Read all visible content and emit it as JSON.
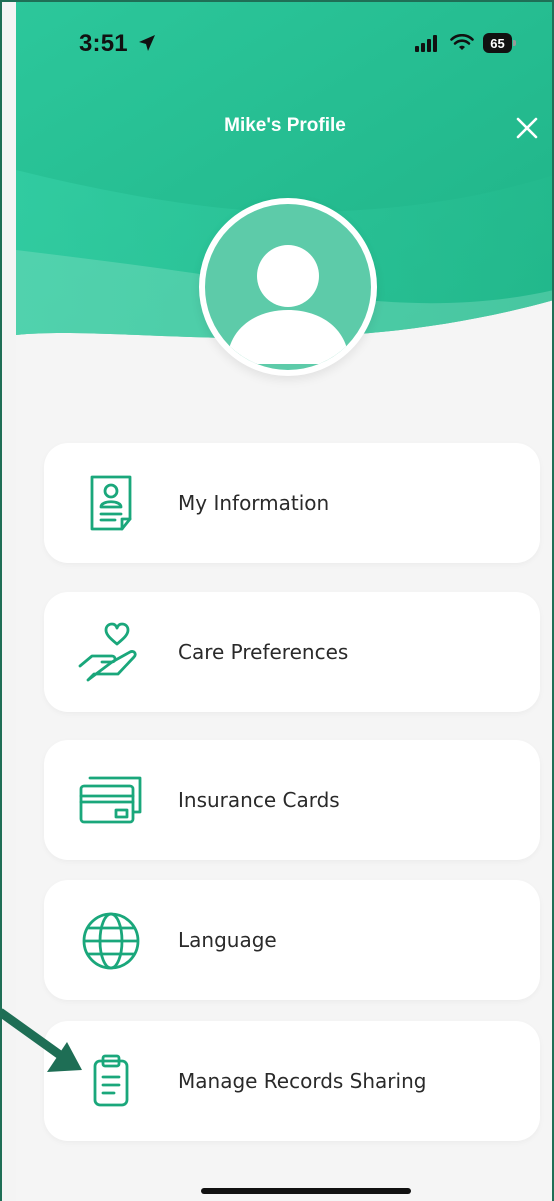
{
  "status_bar": {
    "time": "3:51",
    "battery": "65"
  },
  "header": {
    "title": "Mike's Profile"
  },
  "colors": {
    "brand_green": "#22b98a",
    "icon_green": "#1aa77b",
    "avatar_green": "#5dcba9",
    "annotation_arrow": "#1e6e55"
  },
  "menu": {
    "items": [
      {
        "label": "My Information",
        "icon": "contact-document-icon"
      },
      {
        "label": "Care Preferences",
        "icon": "heart-hand-icon"
      },
      {
        "label": "Insurance Cards",
        "icon": "credit-cards-icon"
      },
      {
        "label": "Language",
        "icon": "globe-icon"
      },
      {
        "label": "Manage Records Sharing",
        "icon": "clipboard-icon"
      }
    ]
  }
}
